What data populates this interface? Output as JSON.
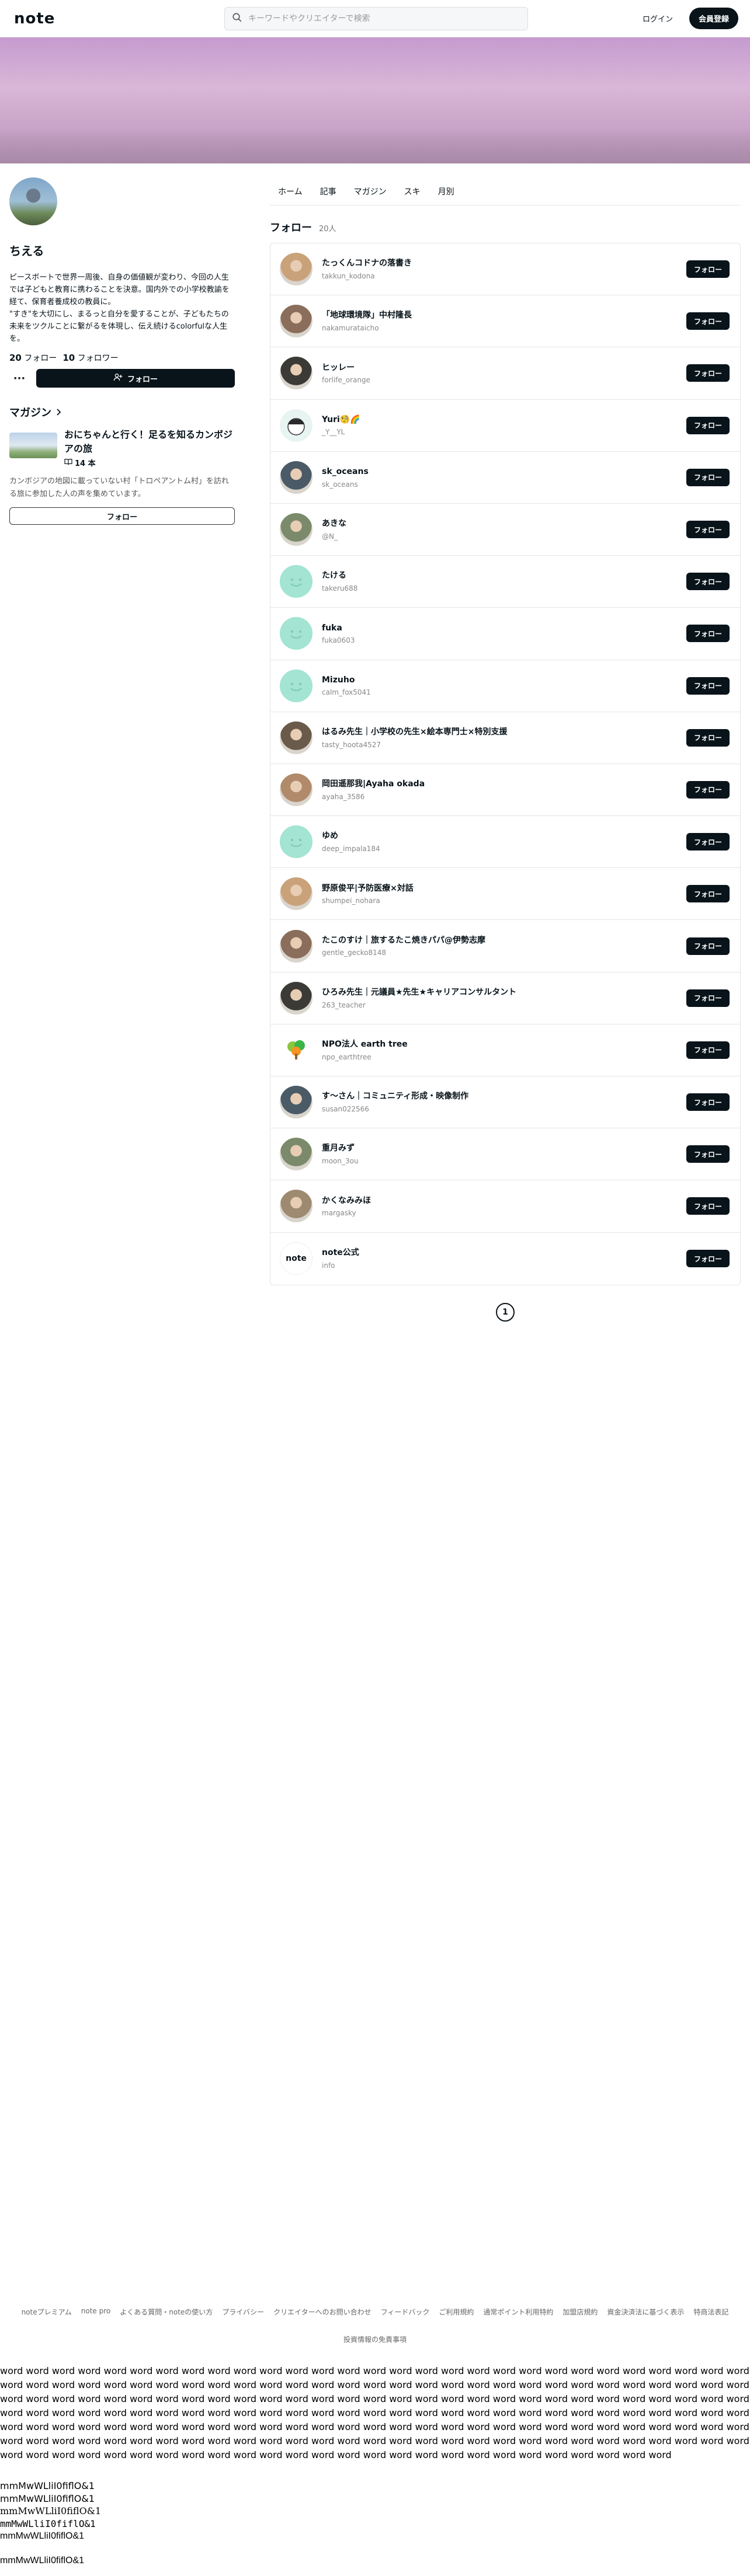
{
  "header": {
    "logo": "note",
    "search_placeholder": "キーワードやクリエイターで検索",
    "login": "ログイン",
    "signup": "会員登録"
  },
  "profile": {
    "name": "ちえる",
    "bio": "ピースボートで世界一周後、自身の価値観が変わり、今回の人生では子どもと教育に携わることを決意。国内外での小学校教諭を経て、保育者養成校の教員に。\n\"すき\"を大切にし、まるっと自分を愛することが、子どもたちの未来をツクルことに繋がるを体現し、伝え続けるcolorfulな人生を。",
    "following_count": "20",
    "following_label": "フォロー",
    "followers_count": "10",
    "followers_label": "フォロワー",
    "follow_button": "フォロー"
  },
  "magazine": {
    "heading": "マガジン",
    "title": "おにちゃんと行く！足るを知るカンボジアの旅",
    "count": "14 本",
    "description": "カンボジアの地図に載っていない村「トロペアントム村」を訪れる旅に参加した人の声を集めています。",
    "follow_button": "フォロー"
  },
  "tabs": [
    "ホーム",
    "記事",
    "マガジン",
    "スキ",
    "月別"
  ],
  "follow_section": {
    "title": "フォロー",
    "count": "20人",
    "button_label": "フォロー",
    "users": [
      {
        "name": "たっくんコドナの落書き",
        "id": "takkun_kodona",
        "avatar": "photo"
      },
      {
        "name": "「地球環境隊」中村隆長",
        "id": "nakamurataicho",
        "avatar": "photo"
      },
      {
        "name": "ヒッレー",
        "id": "forlife_orange",
        "avatar": "photo"
      },
      {
        "name": "Yuri🧐🌈",
        "id": "_Y__YL",
        "avatar": "illust"
      },
      {
        "name": "sk_oceans",
        "id": "sk_oceans",
        "avatar": "photo"
      },
      {
        "name": "あきな",
        "id": "@N_",
        "avatar": "photo"
      },
      {
        "name": "たける",
        "id": "takeru688",
        "avatar": "smile"
      },
      {
        "name": "fuka",
        "id": "fuka0603",
        "avatar": "smile"
      },
      {
        "name": "Mizuho",
        "id": "calm_fox5041",
        "avatar": "smile"
      },
      {
        "name": "はるみ先生｜小学校の先生×絵本専門士×特別支援",
        "id": "tasty_hoota4527",
        "avatar": "photo"
      },
      {
        "name": "岡田遥那我|Ayaha okada",
        "id": "ayaha_3586",
        "avatar": "photo"
      },
      {
        "name": "ゆめ",
        "id": "deep_impala184",
        "avatar": "smile"
      },
      {
        "name": "野原俊平|予防医療×対話",
        "id": "shumpei_nohara",
        "avatar": "photo"
      },
      {
        "name": "たこのすけ｜旅するたこ焼きパパ@伊勢志摩",
        "id": "gentle_gecko8148",
        "avatar": "photo"
      },
      {
        "name": "ひろみ先生｜元議員★先生★キャリアコンサルタント",
        "id": "263_teacher",
        "avatar": "photo"
      },
      {
        "name": "NPO法人 earth tree",
        "id": "npo_earthtree",
        "avatar": "logo-tree"
      },
      {
        "name": "す～さん｜コミュニティ形成・映像制作",
        "id": "susan022566",
        "avatar": "photo"
      },
      {
        "name": "重月みず",
        "id": "moon_3ou",
        "avatar": "photo"
      },
      {
        "name": "かくなみみほ",
        "id": "margasky",
        "avatar": "photo"
      },
      {
        "name": "note公式",
        "id": "info",
        "avatar": "logo-note"
      }
    ]
  },
  "pager": {
    "current": "1"
  },
  "footer": {
    "links": [
      "noteプレミアム",
      "note pro",
      "よくある質問・noteの使い方",
      "プライバシー",
      "クリエイターへのお問い合わせ",
      "フィードバック",
      "ご利用規約",
      "通常ポイント利用特約",
      "加盟店規約",
      "資金決済法に基づく表示",
      "特商法表記"
    ],
    "note": "投資情報の免責事項"
  },
  "test": {
    "words": "word word word word word word word word word word word word word word word word word word word word word word word word word word word word word word word word word word word word word word word word word word word word word word word word word word word word word word word word word word word word word word word word word word word word word word word word word word word word word word word word word word word word word word word word word word word word word word word word word word word word word word word word word word word word word word word word word word word word word word word word word word word word word word word word word word word word word word word word word word word word word word word word word word word word word word word word word word word word word word word word word word word word word word word word word word word word word word word word word word word word word word word word word word word word word word word word word word word word word word word word",
    "lines": [
      "mmMwWLliI0fiflO&1",
      "mmMwWLliI0fiflO&1",
      "mmMwWLliI0fiflO&1",
      "mmMwWLliI0fiflO&1",
      "mmMwWLliI0fiflO&1",
      "",
      "mmMwWLliI0fiflO&1"
    ]
  }
}
